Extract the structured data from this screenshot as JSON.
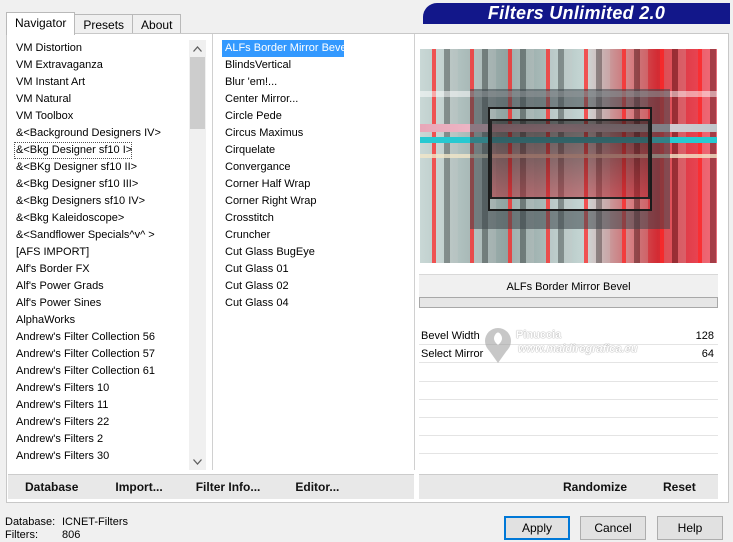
{
  "tabs": [
    {
      "label": "Navigator",
      "active": true
    },
    {
      "label": "Presets",
      "active": false
    },
    {
      "label": "About",
      "active": false
    }
  ],
  "title": "Filters Unlimited 2.0",
  "categories": [
    "VM Distortion",
    "VM Extravaganza",
    "VM Instant Art",
    "VM Natural",
    "VM Toolbox",
    "&<Background Designers IV>",
    "&<Bkg Designer sf10 I>",
    "&<BKg Designer sf10 II>",
    "&<Bkg Designer sf10 III>",
    "&<Bkg Designers sf10 IV>",
    "&<Bkg Kaleidoscope>",
    "&<Sandflower Specials^v^ >",
    "[AFS IMPORT]",
    "Alf's Border FX",
    "Alf's Power Grads",
    "Alf's Power Sines",
    "AlphaWorks",
    "Andrew's Filter Collection 56",
    "Andrew's Filter Collection 57",
    "Andrew's Filter Collection 61",
    "Andrew's Filters 10",
    "Andrew's Filters 11",
    "Andrew's Filters 22",
    "Andrew's Filters 2",
    "Andrew's Filters 30"
  ],
  "selected_category_index": 6,
  "filters": [
    "ALFs Border Mirror Bevel",
    "BlindsVertical",
    "Blur 'em!...",
    "Center Mirror...",
    "Circle Pede",
    "Circus Maximus",
    "Cirquelate",
    "Convergance",
    "Corner Half Wrap",
    "Corner Right Wrap",
    "Crosstitch",
    "Cruncher",
    "Cut Glass  BugEye",
    "Cut Glass 01",
    "Cut Glass 02",
    "Cut Glass 04"
  ],
  "selected_filter_index": 0,
  "selected_filter_name": "ALFs Border Mirror Bevel",
  "params": [
    {
      "label": "Bevel Width",
      "value": "128"
    },
    {
      "label": "Select Mirror",
      "value": "64"
    }
  ],
  "watermark": {
    "brand": "Pinuccia",
    "site": "www.maidiregrafica.eu"
  },
  "toolbar_left": {
    "database": "Database",
    "import": "Import...",
    "filter_info": "Filter Info...",
    "editor": "Editor..."
  },
  "toolbar_right": {
    "randomize": "Randomize",
    "reset": "Reset"
  },
  "info": {
    "database_label": "Database:",
    "database_value": "ICNET-Filters",
    "filters_label": "Filters:",
    "filters_value": "806"
  },
  "buttons": {
    "apply": "Apply",
    "cancel": "Cancel",
    "help": "Help"
  },
  "colors": {
    "banner": "#12178a",
    "selection": "#3399ff"
  }
}
